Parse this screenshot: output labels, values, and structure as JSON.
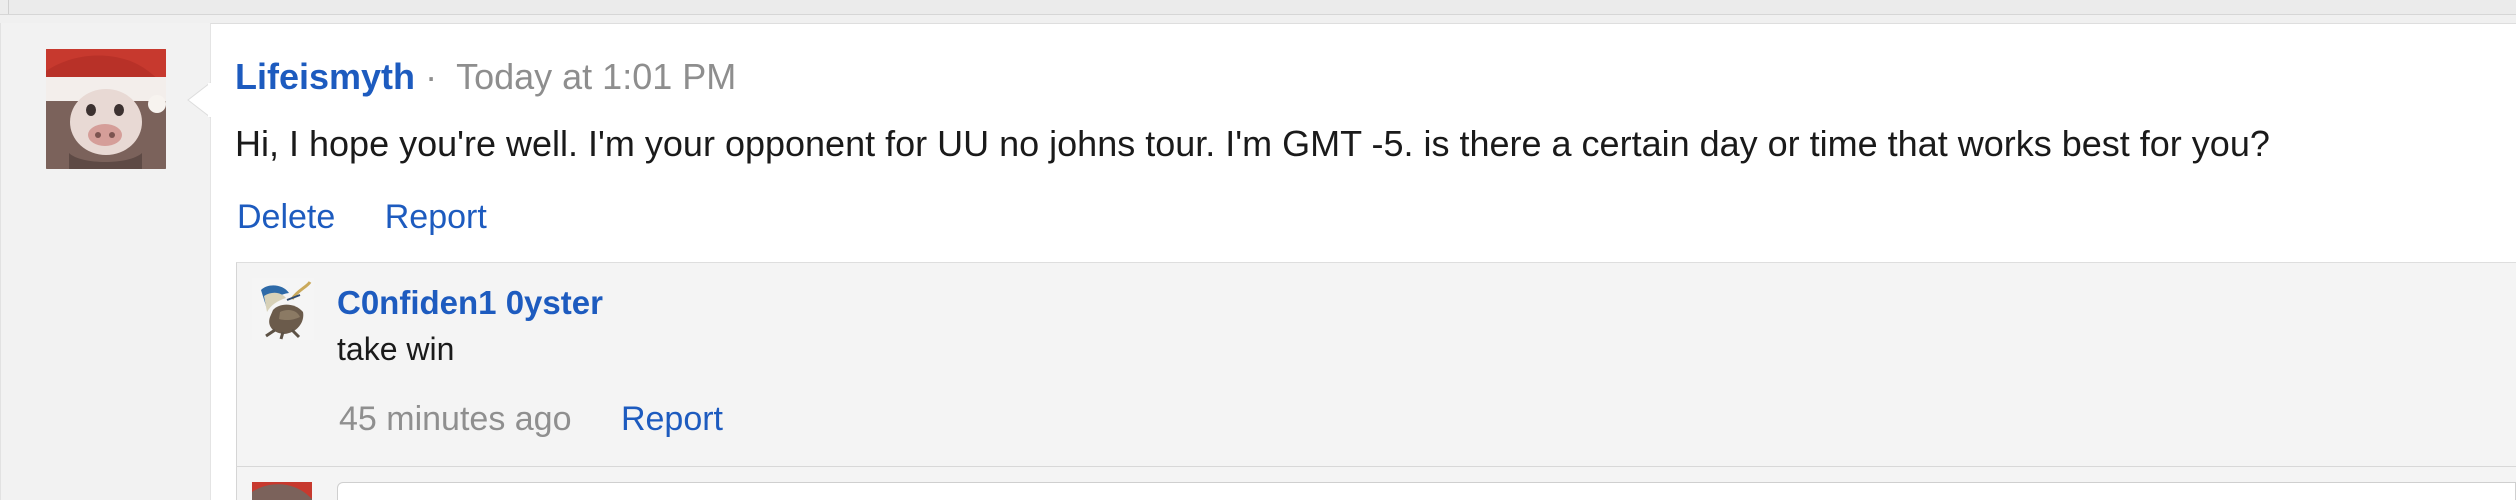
{
  "thread": {
    "message": {
      "author": "Lifeismyth",
      "separator": "·",
      "timestamp": "Today at 1:01 PM",
      "text": "Hi, I hope you're well. I'm your opponent for UU no johns tour. I'm GMT -5. is there a certain day or time that works best for you?",
      "actions": {
        "delete_label": "Delete",
        "report_label": "Report"
      }
    },
    "reply": {
      "author": "C0nfiden1 0yster",
      "text": "take win",
      "timestamp": "45 minutes ago",
      "report_label": "Report"
    },
    "composer": {
      "placeholder": ""
    }
  },
  "icons": {
    "main_avatar": "santa-hat-avatar",
    "reply_avatar": "oyster-avatar",
    "composer_avatar": "santa-hat-avatar"
  },
  "colors": {
    "link": "#1d5bbf",
    "muted": "#8e8e8e",
    "body_text": "#1a1a1a",
    "card_background": "#ffffff",
    "reply_background": "#f4f4f4"
  }
}
